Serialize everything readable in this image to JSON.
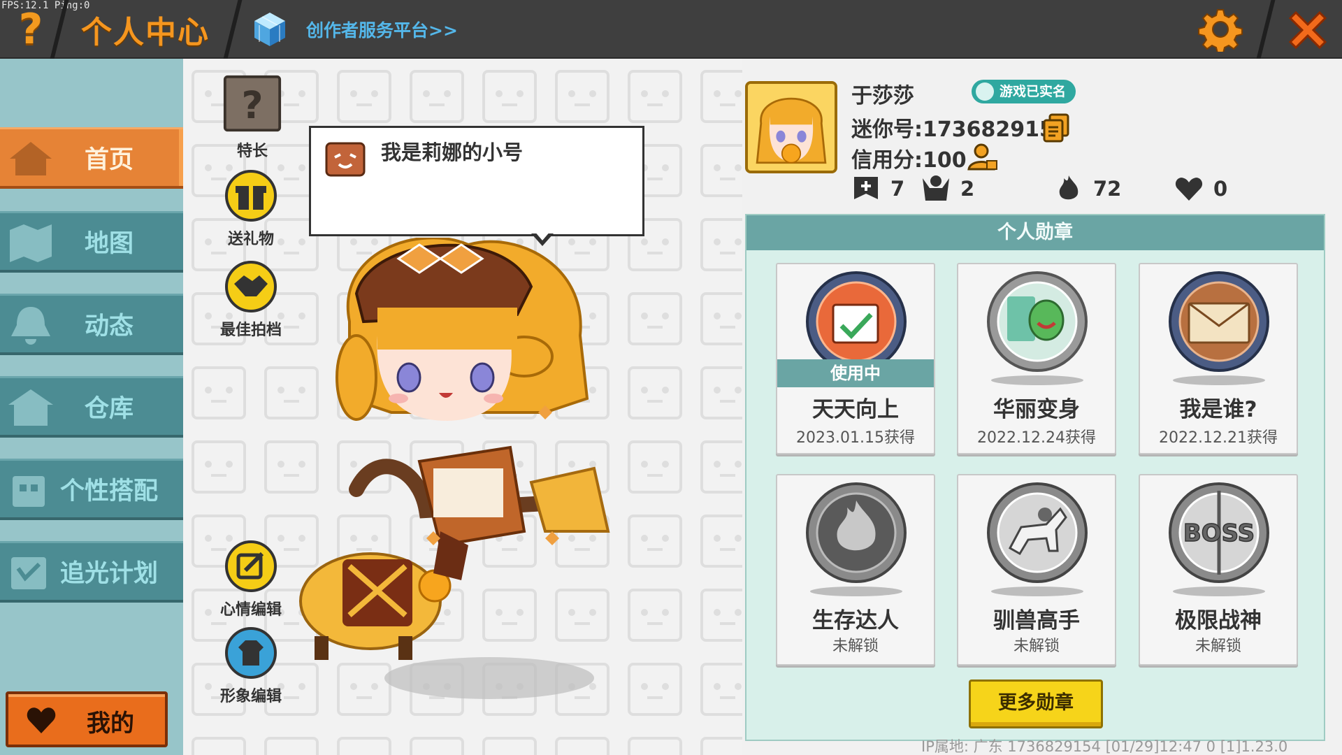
{
  "debug": {
    "fps_text": "FPS:12.1  Ping:0"
  },
  "header": {
    "help_label": "?",
    "title": "个人中心",
    "creator_link": "创作者服务平台>>"
  },
  "sidebar": {
    "items": [
      {
        "label": "首页",
        "active": true
      },
      {
        "label": "地图",
        "active": false
      },
      {
        "label": "动态",
        "active": false
      },
      {
        "label": "仓库",
        "active": false
      },
      {
        "label": "个性搭配",
        "active": false
      },
      {
        "label": "追光计划",
        "active": false
      }
    ],
    "my_button": "我的"
  },
  "actions": {
    "specialty": "特长",
    "specialty_icon_text": "?",
    "gift": "送礼物",
    "best_partner": "最佳拍档",
    "mood_edit": "心情编辑",
    "avatar_edit": "形象编辑"
  },
  "speech": {
    "text": "我是莉娜的小号"
  },
  "profile": {
    "name": "于莎莎",
    "verified": "游戏已实名",
    "mini_id": "迷你号:1736829154",
    "credit": "信用分:100",
    "stats": {
      "friends": "7",
      "fans": "2",
      "popularity": "72",
      "likes": "0"
    }
  },
  "medals": {
    "title": "个人勋章",
    "in_use_label": "使用中",
    "items": [
      {
        "name": "天天向上",
        "status": "2023.01.15获得",
        "in_use": true
      },
      {
        "name": "华丽变身",
        "status": "2022.12.24获得",
        "in_use": false
      },
      {
        "name": "我是谁?",
        "status": "2022.12.21获得",
        "in_use": false
      },
      {
        "name": "生存达人",
        "status": "未解锁",
        "in_use": false
      },
      {
        "name": "驯兽高手",
        "status": "未解锁",
        "in_use": false
      },
      {
        "name": "极限战神",
        "status": "未解锁",
        "in_use": false
      }
    ],
    "boss_text": "BOSS",
    "more_button": "更多勋章"
  },
  "footer": {
    "text": "IP属地: 广东  1736829154  [01/29]12:47 0  [1]1.23.0"
  },
  "colors": {
    "accent_orange": "#f5961f",
    "nav_teal": "#4c8c93",
    "nav_active": "#e68336",
    "medal_header": "#6aa5a4",
    "button_yellow": "#f6d41a",
    "link_blue": "#54b7ea"
  }
}
